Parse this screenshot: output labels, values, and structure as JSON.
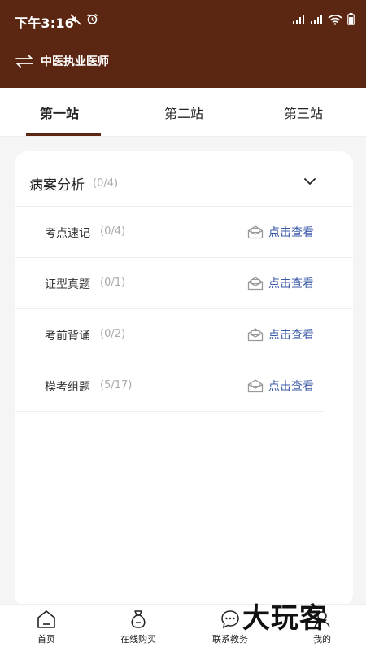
{
  "status_bar": {
    "time": "下午3:16"
  },
  "header": {
    "title": "中医执业医师"
  },
  "tabs": [
    {
      "label": "第一站",
      "active": true
    },
    {
      "label": "第二站",
      "active": false
    },
    {
      "label": "第三站",
      "active": false
    }
  ],
  "section": {
    "title": "病案分析",
    "count": "(0/4)",
    "items": [
      {
        "label": "考点速记",
        "count": "(0/4)",
        "action": "点击查看"
      },
      {
        "label": "证型真题",
        "count": "(0/1)",
        "action": "点击查看"
      },
      {
        "label": "考前背诵",
        "count": "(0/2)",
        "action": "点击查看"
      },
      {
        "label": "模考组题",
        "count": "(5/17)",
        "action": "点击查看"
      }
    ]
  },
  "bottom_nav": [
    {
      "label": "首页",
      "icon": "home-icon"
    },
    {
      "label": "在线购买",
      "icon": "money-bag-icon"
    },
    {
      "label": "联系教务",
      "icon": "chat-bubble-icon"
    },
    {
      "label": "我的",
      "icon": "profile-icon"
    }
  ],
  "watermark": "大玩客",
  "colors": {
    "brand": "#5c2712",
    "link": "#3b5aa8",
    "muted": "#aaaaaa"
  }
}
